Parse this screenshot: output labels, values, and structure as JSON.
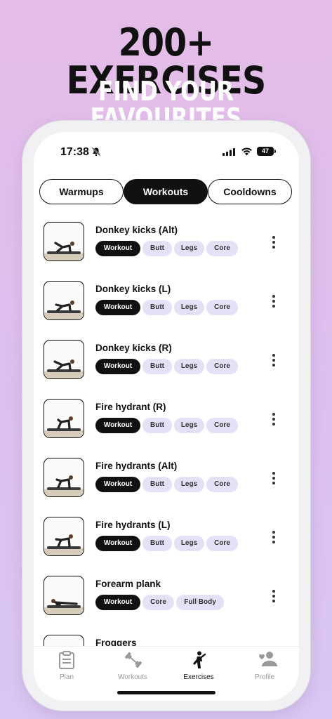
{
  "promo": {
    "headline": "200+ EXERCISES",
    "subheadline": "FIND YOUR FAVOURITES"
  },
  "status_bar": {
    "time": "17:38",
    "battery": "47"
  },
  "tabs": [
    {
      "label": "Warmups",
      "active": false
    },
    {
      "label": "Workouts",
      "active": true
    },
    {
      "label": "Cooldowns",
      "active": false
    }
  ],
  "exercises": [
    {
      "title": "Donkey kicks (Alt)",
      "tags": [
        "Workout",
        "Butt",
        "Legs",
        "Core"
      ]
    },
    {
      "title": "Donkey kicks (L)",
      "tags": [
        "Workout",
        "Butt",
        "Legs",
        "Core"
      ]
    },
    {
      "title": "Donkey kicks (R)",
      "tags": [
        "Workout",
        "Butt",
        "Legs",
        "Core"
      ]
    },
    {
      "title": "Fire hydrant (R)",
      "tags": [
        "Workout",
        "Butt",
        "Legs",
        "Core"
      ]
    },
    {
      "title": "Fire hydrants (Alt)",
      "tags": [
        "Workout",
        "Butt",
        "Legs",
        "Core"
      ]
    },
    {
      "title": "Fire hydrants (L)",
      "tags": [
        "Workout",
        "Butt",
        "Legs",
        "Core"
      ]
    },
    {
      "title": "Forearm plank",
      "tags": [
        "Workout",
        "Core",
        "Full Body"
      ]
    },
    {
      "title": "Froggers",
      "tags": []
    }
  ],
  "nav": [
    {
      "label": "Plan",
      "icon": "clipboard-icon",
      "active": false
    },
    {
      "label": "Workouts",
      "icon": "dumbbell-icon",
      "active": false
    },
    {
      "label": "Exercises",
      "icon": "person-exercise-icon",
      "active": true
    },
    {
      "label": "Profile",
      "icon": "profile-icon",
      "active": false
    }
  ],
  "colors": {
    "accent": "#111111",
    "chip": "#e4e0f6",
    "background": "#e0c0ee"
  }
}
